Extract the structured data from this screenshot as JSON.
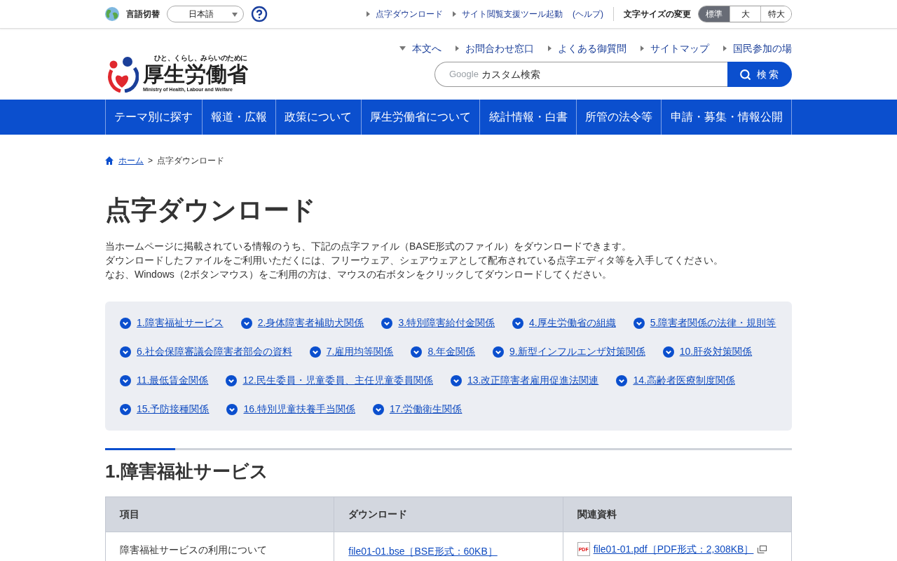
{
  "top_bar": {
    "language_label": "言語切替",
    "language_select": {
      "value": "日本語"
    },
    "links": [
      {
        "label": "点字ダウンロード",
        "kind": "link"
      },
      {
        "label": "サイト閲覧支援ツール起動",
        "kind": "link"
      },
      {
        "label": "(ヘルプ)",
        "kind": "plain"
      }
    ],
    "font_size_label": "文字サイズの変更",
    "font_sizes": [
      {
        "label": "標準",
        "selected": true
      },
      {
        "label": "大",
        "selected": false
      },
      {
        "label": "特大",
        "selected": false
      }
    ]
  },
  "header": {
    "logo": {
      "tagline": "ひと、くらし、みらいのために",
      "name": "厚生労働省",
      "english": "Ministry of Health, Labour and Welfare"
    },
    "utility_links": [
      {
        "label": "本文へ",
        "kind": "skip"
      },
      {
        "label": "お問合わせ窓口",
        "kind": "link"
      },
      {
        "label": "よくある御質問",
        "kind": "link"
      },
      {
        "label": "サイトマップ",
        "kind": "link"
      },
      {
        "label": "国民参加の場",
        "kind": "link"
      }
    ],
    "search": {
      "brand": "Google",
      "placeholder": "カスタム検索",
      "button": "検索"
    }
  },
  "nav": [
    "テーマ別に探す",
    "報道・広報",
    "政策について",
    "厚生労働省について",
    "統計情報・白書",
    "所管の法令等",
    "申請・募集・情報公開"
  ],
  "breadcrumb": {
    "separator": ">",
    "items": [
      {
        "label": "ホーム",
        "kind": "home"
      },
      {
        "label": "点字ダウンロード",
        "kind": "current"
      }
    ]
  },
  "title": "点字ダウンロード",
  "intro": [
    "当ホームページに掲載されている情報のうち、下記の点字ファイル（BASE形式のファイル）をダウンロードできます。",
    "ダウンロードしたファイルをご利用いただくには、フリーウェア、シェアウェアとして配布されている点字エディタ等を入手してください。",
    "なお、Windows（2ボタンマウス）をご利用の方は、マウスの右ボタンをクリックしてダウンロードしてください。"
  ],
  "anchor_links": [
    "1.障害福祉サービス",
    "2.身体障害者補助犬関係",
    "3.特別障害給付金関係",
    "4.厚生労働省の組織",
    "5.障害者関係の法律・規則等",
    "6.社会保障審議会障害者部会の資料",
    "7.雇用均等関係",
    "8.年金関係",
    "9.新型インフルエンザ対策関係",
    "10.肝炎対策関係",
    "11.最低賃金関係",
    "12.民生委員・児童委員、主任児童委員関係",
    "13.改正障害者雇用促進法関連",
    "14.高齢者医療制度関係",
    "15.予防接種関係",
    "16.特別児童扶養手当関係",
    "17.労働衛生関係"
  ],
  "sections": [
    {
      "heading": "1.障害福祉サービス",
      "table": {
        "columns": [
          "項目",
          "ダウンロード",
          "関連資料"
        ],
        "rows": [
          {
            "item": "障害福祉サービスの利用について",
            "download": "file01-01.bse［BSE形式：60KB］",
            "related": {
              "file_type": "PDF",
              "label": "file01-01.pdf［PDF形式：2,308KB］"
            }
          }
        ]
      }
    }
  ]
}
